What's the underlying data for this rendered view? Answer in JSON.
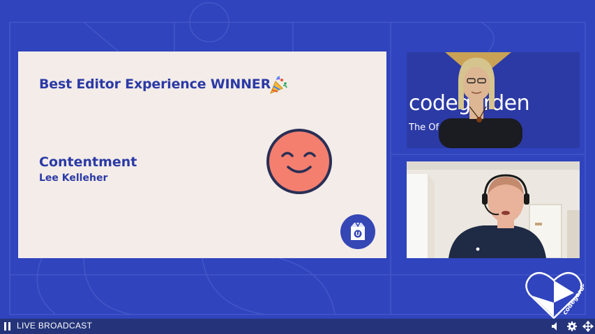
{
  "slide": {
    "title": "Best Editor Experience WINNER",
    "title_emoji": "party-popper-icon",
    "package_name": "Contentment",
    "author": "Lee Kelleher",
    "face": "smiling-face-icon",
    "logo": "umbraco-box-icon"
  },
  "cameras": {
    "presenter": {
      "backdrop_text": "codegarden",
      "backdrop_sub": "The Of                               ference"
    },
    "guest": {}
  },
  "player": {
    "pause": "pause-icon",
    "status": "LIVE BROADCAST",
    "icons": [
      "volume-icon",
      "settings-icon",
      "move-icon"
    ]
  },
  "brand": {
    "logo_text": "codegarden"
  },
  "colors": {
    "background": "#2f44bd",
    "slide": "#f3ece8",
    "accent": "#2b3aa6",
    "smiley": "#f47f6e",
    "bar": "#25347a"
  }
}
